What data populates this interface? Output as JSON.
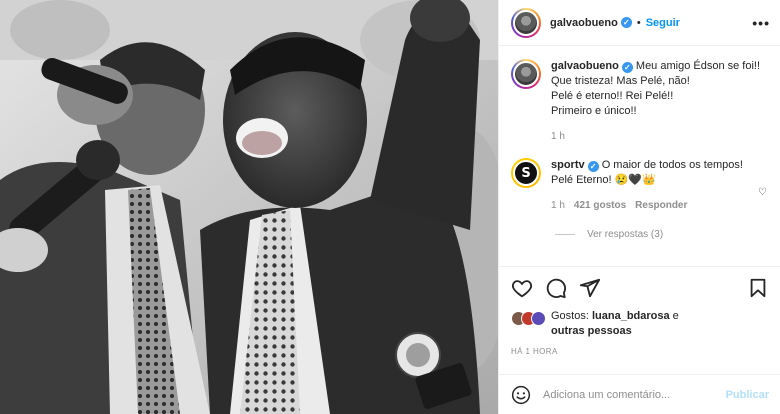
{
  "post": {
    "author": "galvaobueno",
    "follow_label": "Seguir",
    "dot": "•",
    "more_icon": "more-horizontal-icon"
  },
  "caption": {
    "author": "galvaobueno",
    "text": "Meu amigo Édson se foi!!\nQue tristeza! Mas Pelé, não!\nPelé é eterno!! Rei Pelé!!\nPrimeiro e único!!",
    "time": "1 h"
  },
  "comment": {
    "author": "sportv",
    "avatar_letter": "S",
    "text": "O maior de todos os tempos! Pelé Eterno! 😢🖤👑",
    "time": "1 h",
    "likes": "421 gostos",
    "reply_label": "Responder",
    "view_replies": "Ver respostas (3)"
  },
  "actions": {
    "like_icon": "heart-icon",
    "comment_icon": "comment-icon",
    "share_icon": "share-icon",
    "save_icon": "bookmark-icon"
  },
  "likes": {
    "prefix": "Gostos:",
    "user": "luana_bdarosa",
    "suffix": "e",
    "others": "outras pessoas"
  },
  "posted": "HÁ 1 HORA",
  "add_comment": {
    "placeholder": "Adiciona um comentário...",
    "post_label": "Publicar"
  },
  "colors": {
    "link": "#0095f6",
    "verified": "#3897f0",
    "muted": "#8e8e8e"
  }
}
